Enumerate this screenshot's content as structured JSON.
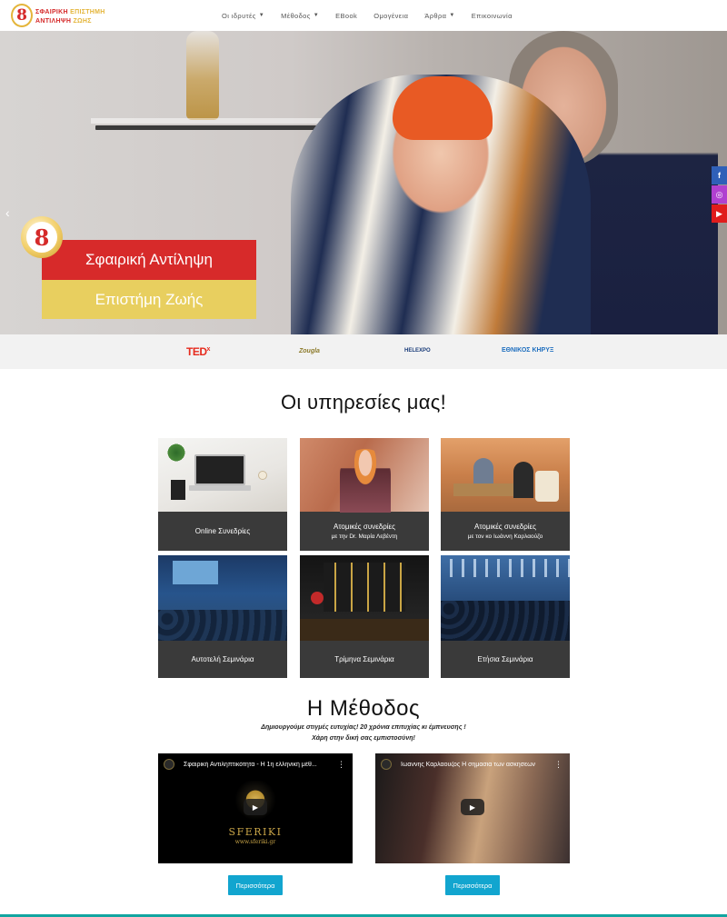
{
  "brand": {
    "logo_mark": "8",
    "line1_left": "ΣΦΑΙΡΙΚΗ",
    "line1_right": "ΕΠΙΣΤΗΜΗ",
    "line2_left": "ΑΝΤΙΛΗΨΗ",
    "line2_right": "ΖΩΗΣ",
    "colors": {
      "red": "#d52a2a",
      "gold": "#e4b53a"
    }
  },
  "nav": {
    "items": [
      {
        "label": "Οι ιδρυτές",
        "has_dropdown": true
      },
      {
        "label": "Μέθοδος",
        "has_dropdown": true
      },
      {
        "label": "EBook",
        "has_dropdown": false
      },
      {
        "label": "Ομογένεια",
        "has_dropdown": false
      },
      {
        "label": "Άρθρα",
        "has_dropdown": true
      },
      {
        "label": "Επικοινωνία",
        "has_dropdown": false
      }
    ]
  },
  "hero": {
    "badge": "8",
    "title_red": "Σφαιρική Αντίληψη",
    "title_yellow": "Επιστήμη Ζωής",
    "prev_arrow": "‹",
    "colors": {
      "red_box": "#d72a2a",
      "yellow_box": "#e8cf5f"
    }
  },
  "social": {
    "items": [
      {
        "icon": "facebook-icon",
        "glyph": "f"
      },
      {
        "icon": "instagram-icon",
        "glyph": "◎"
      },
      {
        "icon": "youtube-icon",
        "glyph": "▶"
      }
    ]
  },
  "press_logos": {
    "ted": "TED",
    "ted_sup": "x",
    "zougla": "Zougla",
    "helexpo": "HELEXPO",
    "ethnikos": "ΕΘΝΙΚΟΣ ΚΗΡΥΞ"
  },
  "services": {
    "title": "Οι υπηρεσίες μας!",
    "cards": [
      {
        "title": "Online Συνεδρίες",
        "sub": ""
      },
      {
        "title": "Ατομικές συνεδρίες",
        "sub": "με την Dr. Μαρία Λεβέντη"
      },
      {
        "title": "Ατομικές συνεδρίες",
        "sub": "με τον κο Ιωάννη Καρλαούζο"
      },
      {
        "title": "Αυτοτελή Σεμινάρια",
        "sub": ""
      },
      {
        "title": "Τρίμηνα Σεμινάρια",
        "sub": ""
      },
      {
        "title": "Ετήσια Σεμινάρια",
        "sub": ""
      }
    ]
  },
  "method": {
    "title": "Η Μέθοδος",
    "subtitle_line1": "Δημιουργούμε στιγμές ευτυχίας! 20 χρόνια επιτυχίας κι έμπνευσης !",
    "subtitle_line2": "Χάρη στην δική σας εμπιστοσύνη!",
    "videos": [
      {
        "title": "Σφαιρική Αντιληπτικότητα - Η 1η ελληνική μέθ...",
        "brand_word": "SFERIKI",
        "brand_url": "www.sferiki.gr"
      },
      {
        "title": "Ιωαννης Καρλαουζος Η σημασια των ασκησεων"
      }
    ],
    "more_label": "Περισσότερα",
    "button_color": "#12a5cf"
  }
}
